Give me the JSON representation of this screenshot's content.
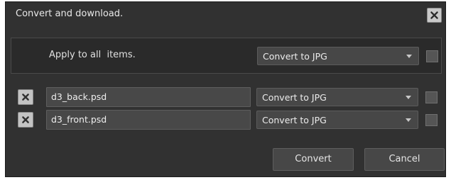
{
  "dialog": {
    "title": "Convert and download.",
    "close_icon": "close-icon"
  },
  "apply_all": {
    "label": "Apply to all  items.",
    "format": "Convert to JPG",
    "checked": false
  },
  "items": [
    {
      "filename": "d3_back.psd",
      "format": "Convert to JPG",
      "checked": false
    },
    {
      "filename": "d3_front.psd",
      "format": "Convert to JPG",
      "checked": false
    }
  ],
  "footer": {
    "convert_label": "Convert",
    "cancel_label": "Cancel"
  },
  "colors": {
    "dialog_bg": "#313131",
    "control_bg": "#474747",
    "text": "#e6e6e6"
  }
}
